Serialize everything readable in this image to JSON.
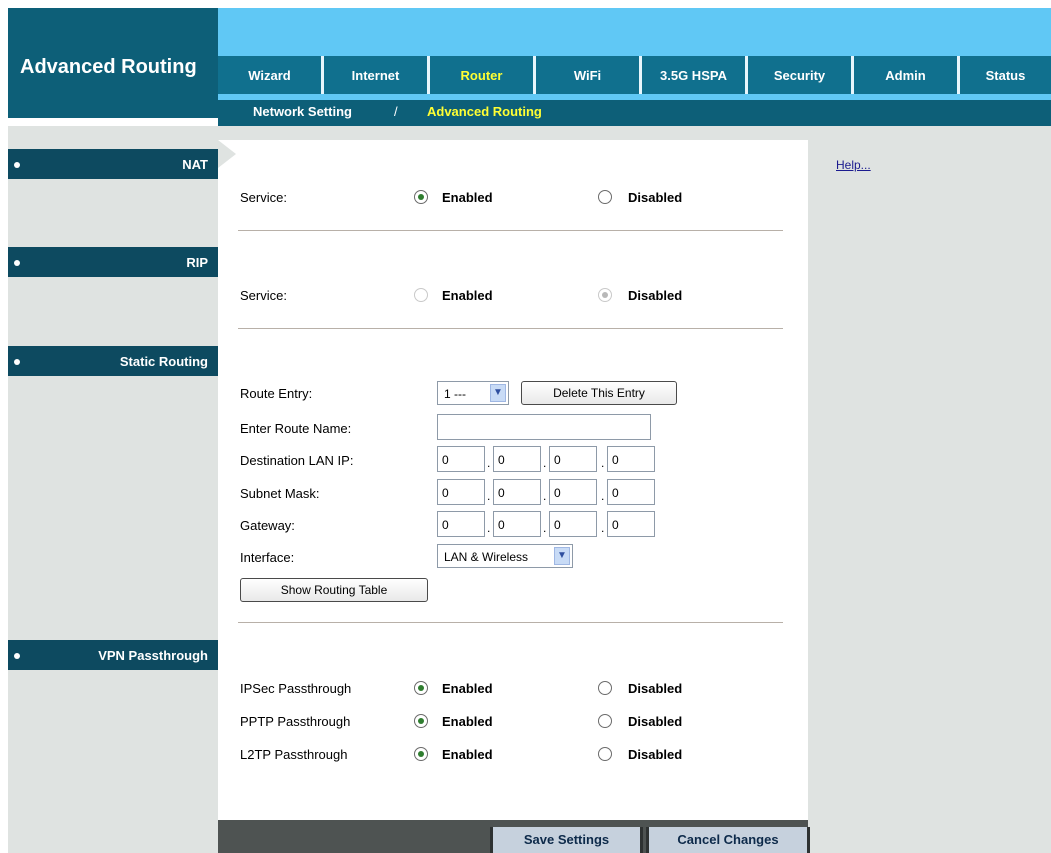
{
  "page_title": "Advanced Routing",
  "tabs": [
    {
      "label": "Wizard"
    },
    {
      "label": "Internet"
    },
    {
      "label": "Router"
    },
    {
      "label": "WiFi"
    },
    {
      "label": "3.5G HSPA"
    },
    {
      "label": "Security"
    },
    {
      "label": "Admin"
    },
    {
      "label": "Status"
    }
  ],
  "subnav": {
    "item1": "Network Setting",
    "separator": "/",
    "item2": "Advanced Routing"
  },
  "sections": {
    "nat": "NAT",
    "rip": "RIP",
    "static_routing": "Static Routing",
    "vpn_passthrough": "VPN Passthrough"
  },
  "help_link": "Help...",
  "nat": {
    "service_label": "Service:",
    "enabled": "Enabled",
    "disabled": "Disabled",
    "selected": "Enabled"
  },
  "rip": {
    "service_label": "Service:",
    "enabled": "Enabled",
    "disabled": "Disabled",
    "selected": "Disabled"
  },
  "static": {
    "route_entry_label": "Route Entry:",
    "route_entry_value": "1 ---",
    "delete_button": "Delete This Entry",
    "route_name_label": "Enter Route Name:",
    "route_name_value": "",
    "dest_label": "Destination LAN IP:",
    "dest_ip": [
      "0",
      "0",
      "0",
      "0"
    ],
    "mask_label": "Subnet Mask:",
    "mask_ip": [
      "0",
      "0",
      "0",
      "0"
    ],
    "gateway_label": "Gateway:",
    "gateway_ip": [
      "0",
      "0",
      "0",
      "0"
    ],
    "ip_separator": ".",
    "interface_label": "Interface:",
    "interface_value": "LAN & Wireless",
    "show_table_button": "Show Routing Table"
  },
  "vpn": {
    "ipsec_label": "IPSec Passthrough",
    "pptp_label": "PPTP Passthrough",
    "l2tp_label": "L2TP Passthrough",
    "enabled": "Enabled",
    "disabled": "Disabled",
    "ipsec": "Enabled",
    "pptp": "Enabled",
    "l2tp": "Enabled"
  },
  "footer": {
    "save": "Save Settings",
    "cancel": "Cancel Changes"
  },
  "colors": {
    "header_dark": "#0d5f78",
    "header_light": "#60c8f5",
    "active_tab": "#ffff33",
    "section_bar": "#0d4a60",
    "panel_gray": "#dfe3e1"
  },
  "icons": {
    "radio_checked": "radio-checked-icon",
    "radio_unchecked": "radio-unchecked-icon",
    "dropdown": "chevron-down-icon",
    "bullet": "bullet-dot-icon"
  }
}
